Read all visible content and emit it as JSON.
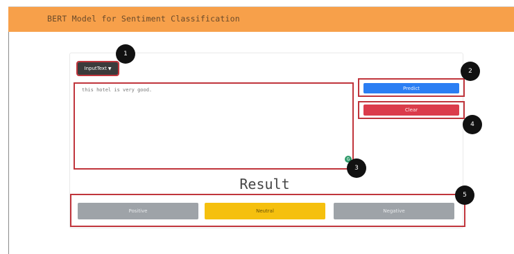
{
  "header": {
    "title": "BERT Model for Sentiment Classification",
    "color": "#f7a04a"
  },
  "input": {
    "dropdown_label": "InputText",
    "text": "this hotel is very good."
  },
  "actions": {
    "predict_label": "Predict",
    "clear_label": "Clear"
  },
  "result": {
    "title": "Result",
    "options": [
      {
        "label": "Positive",
        "selected": false,
        "color": "#9ea3a8"
      },
      {
        "label": "Neutral",
        "selected": true,
        "color": "#f5c00e"
      },
      {
        "label": "Negative",
        "selected": false,
        "color": "#9ea3a8"
      }
    ]
  },
  "annotations": [
    "1",
    "2",
    "3",
    "4",
    "5"
  ],
  "colors": {
    "highlight_border": "#c0343b",
    "predict": "#2a7ef3",
    "clear": "#db3b4b"
  }
}
